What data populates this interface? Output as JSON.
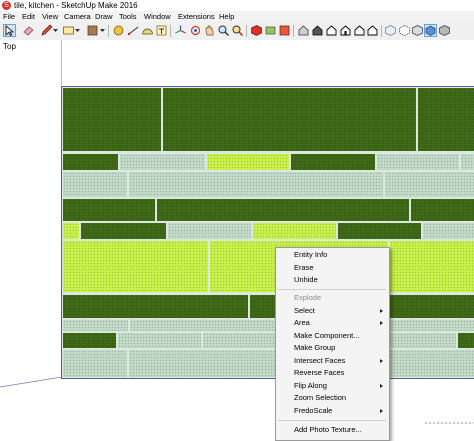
{
  "window": {
    "title": "tile, kitchen - SketchUp Make 2016",
    "app_icon": "sketchup-logo"
  },
  "menu": [
    "File",
    "Edit",
    "View",
    "Camera",
    "Draw",
    "Tools",
    "Window",
    "Extensions",
    "Help"
  ],
  "toolbar": {
    "buttons": [
      {
        "name": "select-tool",
        "icon": "arrow-cursor",
        "selected": true
      },
      {
        "name": "eraser-tool",
        "icon": "eraser"
      },
      {
        "name": "line-tool",
        "icon": "pencil"
      },
      {
        "name": "line-tool-dropdown",
        "icon": "chevron-down"
      },
      {
        "name": "shapes-tool",
        "icon": "rectangle"
      },
      {
        "name": "shapes-tool-dropdown",
        "icon": "chevron-down"
      },
      {
        "name": "paint-bucket-tool",
        "icon": "paint-bucket"
      },
      {
        "name": "paint-dropdown",
        "icon": "chevron-down"
      },
      {
        "name": "tape-measure-tool",
        "icon": "tape-measure"
      },
      {
        "name": "dimension-tool",
        "icon": "dimension"
      },
      {
        "name": "protractor-tool",
        "icon": "protractor"
      },
      {
        "name": "text-tool",
        "icon": "text"
      },
      {
        "name": "axes-tool",
        "icon": "axes"
      },
      {
        "name": "orbit-tool",
        "icon": "orbit"
      },
      {
        "name": "pan-tool",
        "icon": "hand"
      },
      {
        "name": "zoom-tool",
        "icon": "magnifier"
      },
      {
        "name": "zoom-extents-tool",
        "icon": "zoom-extents"
      },
      {
        "name": "warehouse-button",
        "icon": "3d-warehouse"
      },
      {
        "name": "share-model-button",
        "icon": "share"
      },
      {
        "name": "extension-warehouse-button",
        "icon": "extension-warehouse"
      },
      {
        "name": "layout-button",
        "icon": "layout"
      },
      {
        "name": "iso-view-button",
        "icon": "iso-house"
      },
      {
        "name": "top-view-button",
        "icon": "top-house"
      },
      {
        "name": "front-view-button",
        "icon": "front-house"
      },
      {
        "name": "right-view-button",
        "icon": "right-house"
      },
      {
        "name": "back-view-button",
        "icon": "back-house"
      },
      {
        "name": "left-view-button",
        "icon": "left-house"
      },
      {
        "name": "xray-style-button",
        "icon": "xray-cube"
      },
      {
        "name": "back-edges-style-button",
        "icon": "back-edges-cube"
      },
      {
        "name": "wireframe-style-button",
        "icon": "wireframe-cube"
      },
      {
        "name": "textured-style-button",
        "icon": "textured-cube",
        "selected": true
      },
      {
        "name": "monochrome-style-button",
        "icon": "monochrome-cube"
      }
    ]
  },
  "viewport": {
    "view_label": "Top"
  },
  "context_menu": {
    "items": [
      {
        "label": "Entity Info",
        "enabled": true,
        "submenu": false
      },
      {
        "label": "Erase",
        "enabled": true,
        "submenu": false
      },
      {
        "label": "Unhide",
        "enabled": true,
        "submenu": false
      },
      {
        "separator": true
      },
      {
        "label": "Explode",
        "enabled": false,
        "submenu": false
      },
      {
        "label": "Select",
        "enabled": true,
        "submenu": true
      },
      {
        "label": "Area",
        "enabled": true,
        "submenu": true
      },
      {
        "label": "Make Component...",
        "enabled": true,
        "submenu": false
      },
      {
        "label": "Make Group",
        "enabled": true,
        "submenu": false
      },
      {
        "label": "Intersect Faces",
        "enabled": true,
        "submenu": true
      },
      {
        "label": "Reverse Faces",
        "enabled": true,
        "submenu": false
      },
      {
        "label": "Flip Along",
        "enabled": true,
        "submenu": true
      },
      {
        "label": "Zoom Selection",
        "enabled": true,
        "submenu": false
      },
      {
        "label": "FredoScale",
        "enabled": true,
        "submenu": true
      },
      {
        "separator": true
      },
      {
        "label": "Add Photo Texture...",
        "enabled": true,
        "submenu": false
      }
    ]
  },
  "colors": {
    "tile_dark": "#3f6a17",
    "tile_pale": "#c3dbc8",
    "tile_lime": "#c9f34a",
    "grout": "#dbe8dd",
    "selection_blue": "#5a5a9a"
  }
}
